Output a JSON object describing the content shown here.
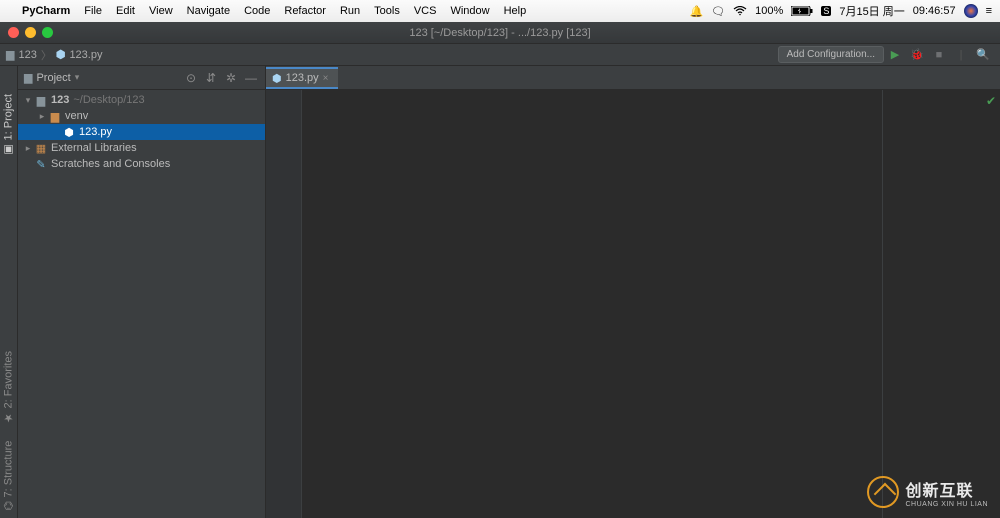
{
  "menubar": {
    "app_name": "PyCharm",
    "items": [
      "File",
      "Edit",
      "View",
      "Navigate",
      "Code",
      "Refactor",
      "Run",
      "Tools",
      "VCS",
      "Window",
      "Help"
    ],
    "battery": "100%",
    "date": "7月15日 周一",
    "time": "09:46:57"
  },
  "window_title": "123 [~/Desktop/123] - .../123.py [123]",
  "breadcrumb": {
    "project": "123",
    "file": "123.py"
  },
  "toolbar": {
    "add_config": "Add Configuration..."
  },
  "side_tabs": {
    "project": "1: Project",
    "favorites": "2: Favorites",
    "structure": "7: Structure"
  },
  "project_panel": {
    "title": "Project"
  },
  "tree": {
    "root": "123",
    "root_path": "~/Desktop/123",
    "venv": "venv",
    "file": "123.py",
    "external": "External Libraries",
    "scratches": "Scratches and Consoles"
  },
  "editor_tab": {
    "file": "123.py"
  },
  "watermark": {
    "cn": "创新互联",
    "en": "CHUANG XIN HU LIAN"
  }
}
